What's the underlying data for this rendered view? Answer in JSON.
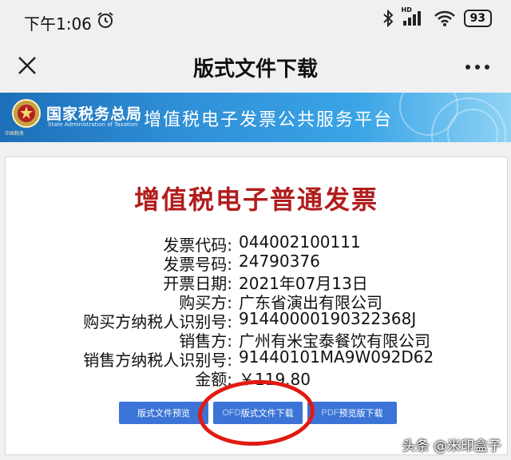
{
  "status_bar": {
    "time": "下午1:06",
    "hd_label": "HD",
    "battery": "93"
  },
  "navbar": {
    "title": "版式文件下载"
  },
  "banner": {
    "org_name": "国家税务总局",
    "org_english": "State Administration of Taxation",
    "emblem_caption": "中国税务",
    "platform_title": "增值税电子发票公共服务平台"
  },
  "invoice": {
    "title": "增值税电子普通发票",
    "fields": [
      {
        "label": "发票代码:",
        "value": "044002100111"
      },
      {
        "label": "发票号码:",
        "value": "24790376"
      },
      {
        "label": "开票日期:",
        "value": "2021年07月13日"
      },
      {
        "label": "购买方:",
        "value": "广东省演出有限公司"
      },
      {
        "label": "购买方纳税人识别号:",
        "value": "91440000190322368J"
      },
      {
        "label": "销售方:",
        "value": "广州有米宝泰餐饮有限公司"
      },
      {
        "label": "销售方纳税人识别号:",
        "value": "91440101MA9W092D62"
      },
      {
        "label": "金额:",
        "value": "￥119.80"
      }
    ]
  },
  "buttons": {
    "preview": "版式文件预览",
    "ofd_prefix": "OFD",
    "ofd_label": "版式文件下载",
    "pdf_prefix": "PDF",
    "pdf_label": "预览版下载"
  },
  "watermark": "头条 @米印盒子",
  "colors": {
    "invoice_title": "#b11d1d",
    "button": "#3b74d6",
    "highlight": "#e11a12",
    "banner": "#2f8fd6"
  }
}
